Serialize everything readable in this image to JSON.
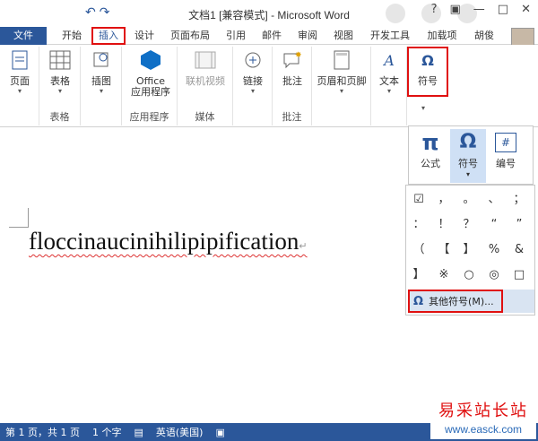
{
  "window": {
    "title": "文档1 [兼容模式] - Microsoft Word",
    "qat_icons": [
      "undo-icon",
      "redo-icon"
    ]
  },
  "tabs": {
    "file": "文件",
    "items": [
      "开始",
      "插入",
      "设计",
      "页面布局",
      "引用",
      "邮件",
      "审阅",
      "视图",
      "开发工具",
      "加载项"
    ],
    "active": "插入",
    "user": "胡俊"
  },
  "ribbon": {
    "pages": {
      "label": "页面"
    },
    "tables": {
      "label": "表格",
      "group": "表格"
    },
    "illustrations": {
      "label": "插图"
    },
    "apps": {
      "office_label_1": "Office",
      "office_label_2": "应用程序",
      "group": "应用程序"
    },
    "media": {
      "label": "联机视频",
      "group": "媒体"
    },
    "links": {
      "label": "链接"
    },
    "comments": {
      "label": "批注",
      "group": "批注"
    },
    "header_footer": {
      "label": "页眉和页脚"
    },
    "text": {
      "label": "文本"
    },
    "symbols": {
      "label": "符号"
    }
  },
  "document": {
    "text": "floccinaucinihilipipification"
  },
  "symbols_popup": {
    "buttons": [
      {
        "icon": "π",
        "label": "公式"
      },
      {
        "icon": "Ω",
        "label": "符号"
      },
      {
        "icon": "#",
        "label": "编号"
      }
    ],
    "grid": [
      "☑",
      "，",
      "。",
      "、",
      "；",
      "：",
      "！",
      "？",
      "“",
      "”",
      "（",
      "【",
      "】",
      "%",
      "&",
      "】",
      "※",
      "○",
      "◎",
      "□"
    ],
    "more": {
      "icon": "Ω",
      "label": "其他符号(M)..."
    }
  },
  "status": {
    "page": "第 1 页，共 1 页",
    "words": "1 个字",
    "lang": "英语(美国)"
  },
  "watermark": {
    "cn": "易采站长站",
    "url": "www.easck.com"
  },
  "colors": {
    "accent": "#2b579a",
    "highlight": "#e01010"
  }
}
